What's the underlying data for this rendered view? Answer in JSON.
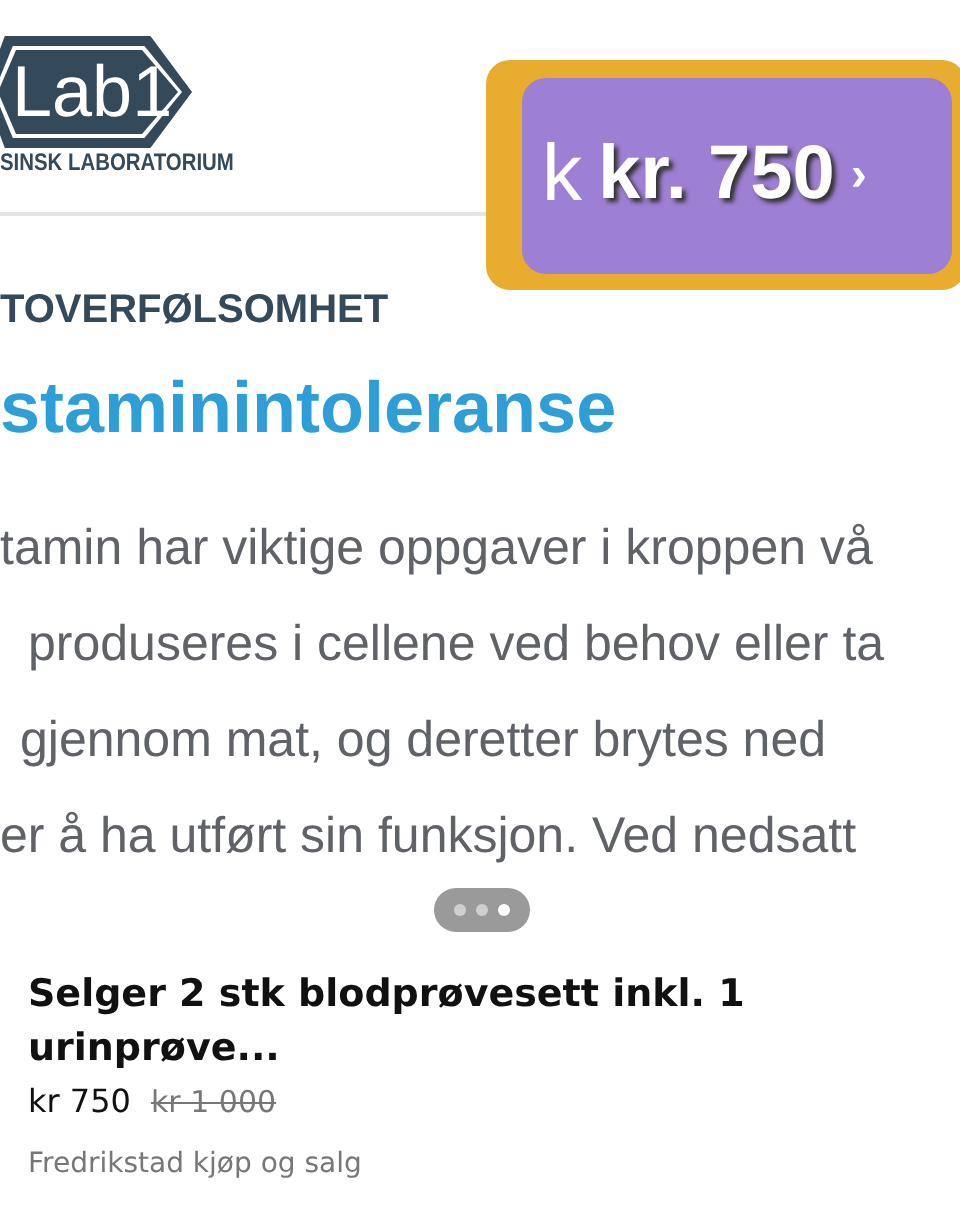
{
  "photo": {
    "logo": {
      "mark": "Lab1",
      "subtitle": "SINSK LABORATORIUM"
    },
    "price_sticker": {
      "prefix": "k",
      "price": "kr. 750",
      "suffix": "›"
    },
    "category": "TOVERFØLSOMHET",
    "heading": "staminintoleranse",
    "paragraph_lines": [
      "tamin har viktige oppgaver i kroppen vå",
      "produseres i cellene ved behov eller ta",
      "gjennom mat, og deretter brytes ned",
      "er å ha utført sin funksjon. Ved nedsatt"
    ],
    "page_dots": [
      {
        "selected": false
      },
      {
        "selected": false
      },
      {
        "selected": true
      }
    ]
  },
  "listing": {
    "title": "Selger  2 stk blodprøvesett inkl. 1 urinprøve...",
    "price": "kr 750",
    "old_price": "kr 1 000",
    "location": "Fredrikstad kjøp og salg"
  }
}
